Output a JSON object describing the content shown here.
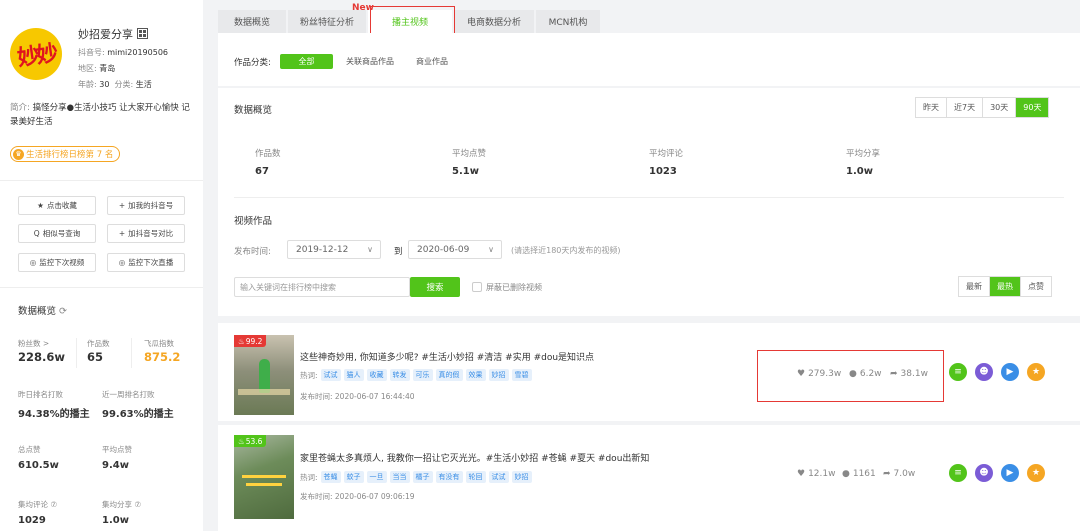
{
  "profile": {
    "name": "妙招爱分享",
    "douyin_id_label": "抖音号:",
    "douyin_id": "mimi20190506",
    "region_label": "地区:",
    "region": "青岛",
    "age_label": "年龄:",
    "age": "30",
    "category_label": "分类:",
    "category": "生活",
    "avatar_text": "妙妙",
    "intro_label": "简介:",
    "intro": "搞怪分享●生活小技巧 让大家开心愉快 记录美好生活",
    "rank_badge": "生活排行榜日榜第 7 名"
  },
  "sidebar_buttons": [
    {
      "icon": "★",
      "label": "点击收藏"
    },
    {
      "icon": "+",
      "label": "加我的抖音号"
    },
    {
      "icon": "Q",
      "label": "相似号查询"
    },
    {
      "icon": "+",
      "label": "加抖音号对比"
    },
    {
      "icon": "◎",
      "label": "监控下次视频"
    },
    {
      "icon": "◎",
      "label": "监控下次直播"
    }
  ],
  "side_overview": {
    "title": "数据概览",
    "fans_label": "粉丝数 >",
    "fans": "228.6w",
    "works_label": "作品数",
    "works": "65",
    "gua_label": "飞瓜指数",
    "gua": "875.2",
    "yesterday_rank_label": "昨日排名打败",
    "yesterday_rank": "94.38%的播主",
    "week_rank_label": "近一周排名打败",
    "week_rank": "99.63%的播主",
    "total_likes_label": "总点赞",
    "total_likes": "610.5w",
    "avg_likes_label": "平均点赞",
    "avg_likes": "9.4w",
    "avg_comments_label": "集均评论 ⑦",
    "avg_comments": "1029",
    "avg_shares_label": "集均分享 ⑦",
    "avg_shares": "1.0w"
  },
  "tabs": [
    "数据概览",
    "粉丝特征分析",
    "播主视频",
    "电商数据分析",
    "MCN机构"
  ],
  "tab_new": "New",
  "filter": {
    "label": "作品分类:",
    "options": [
      "全部",
      "关联商品作品",
      "商业作品"
    ]
  },
  "overview": {
    "title": "数据概览",
    "ranges": [
      "昨天",
      "近7天",
      "30天",
      "90天"
    ],
    "metrics": [
      {
        "label": "作品数",
        "value": "67"
      },
      {
        "label": "平均点赞",
        "value": "5.1w"
      },
      {
        "label": "平均评论",
        "value": "1023"
      },
      {
        "label": "平均分享",
        "value": "1.0w"
      }
    ]
  },
  "videos_section": {
    "title": "视频作品",
    "time_label": "发布时间:",
    "date_from": "2019-12-12",
    "to_label": "到",
    "date_to": "2020-06-09",
    "hint": "(请选择近180天内发布的视频)",
    "search_placeholder": "输入关键词在排行榜中搜索",
    "search_button": "搜索",
    "hide_deleted": "屏蔽已删除视频",
    "sorts": [
      "最新",
      "最热",
      "点赞"
    ]
  },
  "videos": [
    {
      "heat": "99.2",
      "title": "这些神奇妙用, 你知道多少呢? #生活小妙招 #清洁 #实用 #dou是知识点",
      "hot_label": "热词:",
      "tags": [
        "试试",
        "猫人",
        "收藏",
        "转发",
        "可乐",
        "真的假",
        "效果",
        "妙招",
        "雪碧"
      ],
      "time": "发布时间: 2020-06-07 16:44:40",
      "likes": "279.3w",
      "comments": "6.2w",
      "shares": "38.1w"
    },
    {
      "heat": "53.6",
      "title": "家里苍蝇太多真烦人, 我教你一招让它灭光光。#生活小妙招 #苍蝇 #夏天 #dou出新知",
      "hot_label": "热词:",
      "tags": [
        "苍蝇",
        "蚊子",
        "一旦",
        "当当",
        "橘子",
        "有没有",
        "轮回",
        "试试",
        "妙招"
      ],
      "time": "发布时间: 2020-06-07 09:06:19",
      "likes": "12.1w",
      "comments": "1161",
      "shares": "7.0w"
    }
  ],
  "colors": {
    "accent": "#52c41a",
    "highlight": "#e53935",
    "orange": "#f5a623"
  }
}
